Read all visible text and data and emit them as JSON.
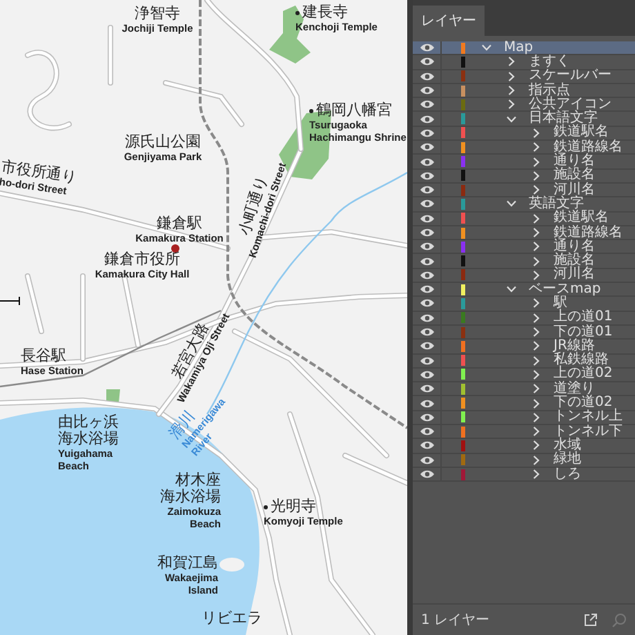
{
  "map": {
    "labels": [
      {
        "kind": "place",
        "ja": [
          "浄智寺"
        ],
        "en": [
          "Jochiji Temple"
        ]
      },
      {
        "kind": "poi",
        "ja": [
          "建長寺"
        ],
        "en": [
          "Kenchoji Temple"
        ]
      },
      {
        "kind": "poi",
        "ja": [
          "鶴岡八幡宮"
        ],
        "en": [
          "Tsurugaoka",
          "Hachimangu Shrine"
        ]
      },
      {
        "kind": "place",
        "ja": [
          "源氏山公園"
        ],
        "en": [
          "Genjiyama Park"
        ]
      },
      {
        "kind": "street",
        "ja": [
          "市役所通り"
        ],
        "en": [
          "ho-dori Street"
        ]
      },
      {
        "kind": "place",
        "ja": [
          "鎌倉駅"
        ],
        "en": [
          "Kamakura Station"
        ]
      },
      {
        "kind": "place",
        "ja": [
          "鎌倉市役所"
        ],
        "en": [
          "Kamakura City Hall"
        ]
      },
      {
        "kind": "street",
        "ja": [
          "小町通り"
        ],
        "en": [
          "Komachi-dori Street"
        ]
      },
      {
        "kind": "place",
        "ja": [
          "長谷駅"
        ],
        "en": [
          "Hase Station"
        ]
      },
      {
        "kind": "street",
        "ja": [
          "若宮大路"
        ],
        "en": [
          "Wakamiya Oji Street"
        ]
      },
      {
        "kind": "river",
        "ja": [
          "滑川"
        ],
        "en": [
          "Namerigawa",
          "River"
        ]
      },
      {
        "kind": "place",
        "ja": [
          "由比ヶ浜",
          "海水浴場"
        ],
        "en": [
          "Yuigahama",
          "Beach"
        ]
      },
      {
        "kind": "place",
        "ja": [
          "材木座",
          "海水浴場"
        ],
        "en": [
          "Zaimokuza",
          "Beach"
        ]
      },
      {
        "kind": "poi",
        "ja": [
          "光明寺"
        ],
        "en": [
          "Komyoji Temple"
        ]
      },
      {
        "kind": "place",
        "ja": [
          "和賀江島"
        ],
        "en": [
          "Wakaejima",
          "Island"
        ]
      },
      {
        "kind": "place",
        "ja": [
          "リビエラ"
        ]
      }
    ]
  },
  "panel": {
    "tab": {
      "label": "レイヤー",
      "selected": true
    },
    "layers": [
      {
        "name": "Map",
        "color": "#f07a20",
        "visible": true,
        "expanded": true,
        "selected": true,
        "children": [
          {
            "name": "ますく",
            "color": "#111111",
            "visible": true,
            "expanded": false,
            "selected": false
          },
          {
            "name": "スケールバー",
            "color": "#8b3010",
            "visible": true,
            "expanded": false,
            "selected": false
          },
          {
            "name": "指示点",
            "color": "#c89060",
            "visible": true,
            "expanded": false,
            "selected": false
          },
          {
            "name": "公共アイコン",
            "color": "#6b6b10",
            "visible": true,
            "expanded": false,
            "selected": false
          },
          {
            "name": "日本語文字",
            "color": "#2a9a9a",
            "visible": true,
            "expanded": true,
            "selected": false,
            "children": [
              {
                "name": "鉄道駅名",
                "color": "#f05050",
                "visible": true,
                "expanded": false,
                "selected": false
              },
              {
                "name": "鉄道路線名",
                "color": "#f09020",
                "visible": true,
                "expanded": false,
                "selected": false
              },
              {
                "name": "通り名",
                "color": "#8a30f0",
                "visible": true,
                "expanded": false,
                "selected": false
              },
              {
                "name": "施設名",
                "color": "#111111",
                "visible": true,
                "expanded": false,
                "selected": false
              },
              {
                "name": "河川名",
                "color": "#8b2a10",
                "visible": true,
                "expanded": false,
                "selected": false
              }
            ]
          },
          {
            "name": "英語文字",
            "color": "#2a9a9a",
            "visible": true,
            "expanded": true,
            "selected": false,
            "children": [
              {
                "name": "鉄道駅名",
                "color": "#f05050",
                "visible": true,
                "expanded": false,
                "selected": false
              },
              {
                "name": "鉄道路線名",
                "color": "#f09020",
                "visible": true,
                "expanded": false,
                "selected": false
              },
              {
                "name": "通り名",
                "color": "#8a30f0",
                "visible": true,
                "expanded": false,
                "selected": false
              },
              {
                "name": "施設名",
                "color": "#111111",
                "visible": true,
                "expanded": false,
                "selected": false
              },
              {
                "name": "河川名",
                "color": "#8b2a10",
                "visible": true,
                "expanded": false,
                "selected": false
              }
            ]
          },
          {
            "name": "ベースmap",
            "color": "#f0f060",
            "visible": true,
            "expanded": true,
            "selected": false,
            "children": [
              {
                "name": "駅",
                "color": "#2a9a9a",
                "visible": true,
                "expanded": false,
                "selected": false
              },
              {
                "name": "上の道01",
                "color": "#3a7a20",
                "visible": true,
                "expanded": false,
                "selected": false
              },
              {
                "name": "下の道01",
                "color": "#8b3010",
                "visible": true,
                "expanded": false,
                "selected": false
              },
              {
                "name": "JR線路",
                "color": "#f07020",
                "visible": true,
                "expanded": false,
                "selected": false
              },
              {
                "name": "私鉄線路",
                "color": "#f05050",
                "visible": true,
                "expanded": false,
                "selected": false
              },
              {
                "name": "上の道02",
                "color": "#80f050",
                "visible": true,
                "expanded": false,
                "selected": false
              },
              {
                "name": "道塗り",
                "color": "#a0c030",
                "visible": true,
                "expanded": false,
                "selected": false
              },
              {
                "name": "下の道02",
                "color": "#f09020",
                "visible": true,
                "expanded": false,
                "selected": false
              },
              {
                "name": "トンネル上",
                "color": "#80f050",
                "visible": true,
                "expanded": false,
                "selected": false
              },
              {
                "name": "トンネル下",
                "color": "#f07020",
                "visible": true,
                "expanded": false,
                "selected": false
              },
              {
                "name": "水域",
                "color": "#a01010",
                "visible": true,
                "expanded": false,
                "selected": false
              },
              {
                "name": "緑地",
                "color": "#a06a10",
                "visible": true,
                "expanded": false,
                "selected": false
              },
              {
                "name": "しろ",
                "color": "#a01838",
                "visible": true,
                "expanded": false,
                "selected": false
              }
            ]
          }
        ]
      }
    ],
    "footer": "1 レイヤー"
  }
}
